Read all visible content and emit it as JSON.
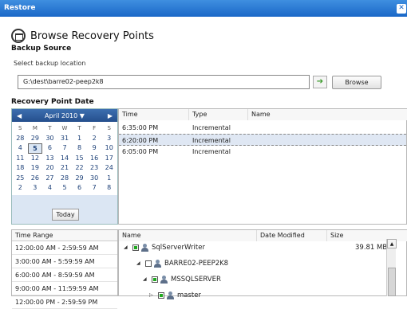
{
  "window": {
    "title": "Restore",
    "close_glyph": "✕"
  },
  "header": {
    "title": "Browse Recovery Points",
    "icon": "open-folder-icon"
  },
  "backup_source": {
    "heading": "Backup Source",
    "label": "Select backup location",
    "path": "G:\\dest\\barre02-peep2k8",
    "go_glyph": "➔",
    "browse_label": "Browse"
  },
  "recovery_date": {
    "heading": "Recovery Point Date",
    "calendar": {
      "month_label": "April 2010",
      "prev_glyph": "◀",
      "next_glyph": "▶",
      "dropdown_glyph": "▼",
      "day_headers": [
        "S",
        "M",
        "T",
        "W",
        "T",
        "F",
        "S"
      ],
      "weeks": [
        [
          "28",
          "29",
          "30",
          "31",
          "1",
          "2",
          "3"
        ],
        [
          "4",
          "5",
          "6",
          "7",
          "8",
          "9",
          "10"
        ],
        [
          "11",
          "12",
          "13",
          "14",
          "15",
          "16",
          "17"
        ],
        [
          "18",
          "19",
          "20",
          "21",
          "22",
          "23",
          "24"
        ],
        [
          "25",
          "26",
          "27",
          "28",
          "29",
          "30",
          "1"
        ],
        [
          "2",
          "3",
          "4",
          "5",
          "6",
          "7",
          "8"
        ]
      ],
      "selected_day": "5",
      "today_label": "Today"
    }
  },
  "points_table": {
    "columns": [
      "Time",
      "Type",
      "Name"
    ],
    "rows": [
      {
        "time": "6:35:00 PM",
        "type": "Incremental",
        "name": ""
      },
      {
        "time": "6:20:00 PM",
        "type": "Incremental",
        "name": ""
      },
      {
        "time": "6:05:00 PM",
        "type": "Incremental",
        "name": ""
      }
    ],
    "selected_index": 1
  },
  "time_range": {
    "heading": "Time Range",
    "items": [
      "12:00:00 AM - 2:59:59 AM",
      "3:00:00 AM - 5:59:59 AM",
      "6:00:00 AM - 8:59:59 AM",
      "9:00:00 AM - 11:59:59 AM",
      "12:00:00 PM - 2:59:59 PM"
    ]
  },
  "tree": {
    "columns": [
      "Name",
      "Date Modified",
      "Size"
    ],
    "nodes": [
      {
        "label": "SqlServerWriter",
        "size": "39.81 MB",
        "expander": "◢",
        "checked": true
      },
      {
        "label": "BARRE02-PEEP2K8",
        "size": "",
        "expander": "◢",
        "checked": false
      },
      {
        "label": "MSSQLSERVER",
        "size": "",
        "expander": "◢",
        "checked": true
      },
      {
        "label": "master",
        "size": "",
        "expander": "▷",
        "checked": true
      }
    ],
    "scroll_up_glyph": "▲"
  }
}
